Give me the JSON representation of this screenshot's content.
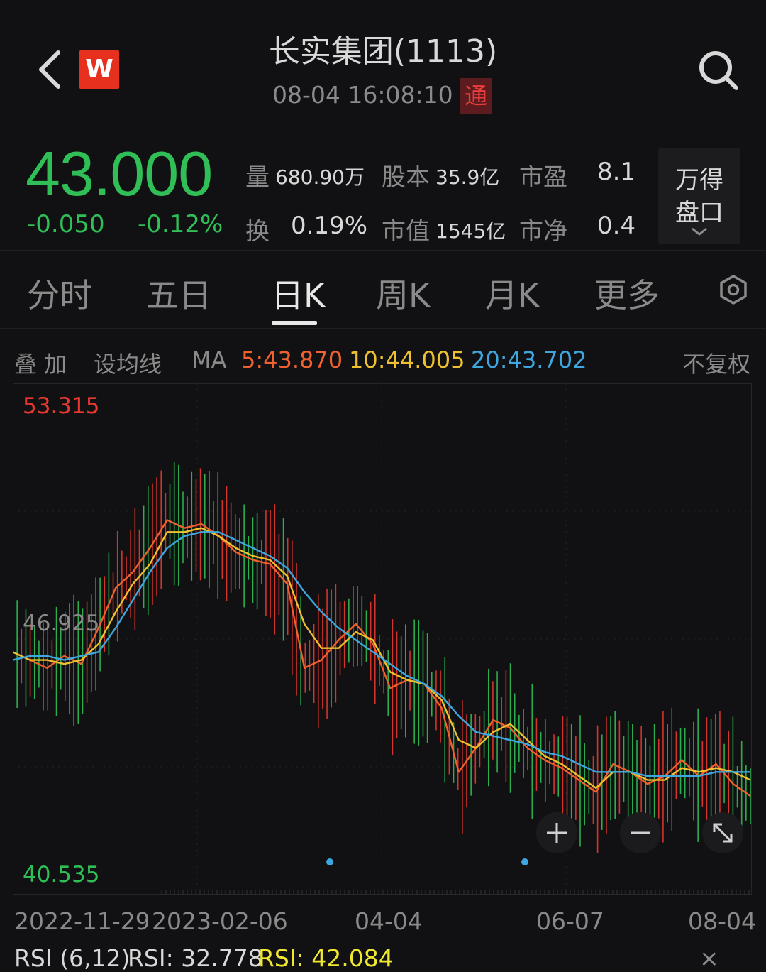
{
  "header": {
    "title": "长实集团(1113)",
    "datetime": "08-04 16:08:10",
    "tong_badge": "通",
    "logo_text": "W"
  },
  "quote": {
    "price": "43.000",
    "change": "-0.050",
    "change_pct": "-0.12%",
    "stats": {
      "volume_label": "量",
      "volume_value": "680.90万",
      "capital_label": "股本",
      "capital_value": "35.9亿",
      "pe_label": "市盈",
      "pe_value": "8.1",
      "turnover_label": "换",
      "turnover_value": "0.19%",
      "mcap_label": "市值",
      "mcap_value": "1545亿",
      "pb_label": "市净",
      "pb_value": "0.4"
    },
    "wind_button": {
      "line1": "万得",
      "line2": "盘口"
    }
  },
  "tabs": [
    {
      "label": "分时"
    },
    {
      "label": "五日"
    },
    {
      "label": "日K"
    },
    {
      "label": "周K"
    },
    {
      "label": "月K"
    },
    {
      "label": "更多"
    }
  ],
  "active_tab": "日K",
  "ma_bar": {
    "overlay": "叠 加",
    "set_ma": "设均线",
    "ma": "MA",
    "ma5": "5:43.870",
    "ma10": "10:44.005",
    "ma20": "20:43.702",
    "adjust": "不复权"
  },
  "colors": {
    "up": "#e8382f",
    "down": "#2fbf56",
    "ma5": "#f0612e",
    "ma10": "#efc12e",
    "ma20": "#3ea7df",
    "bg": "#111113"
  },
  "chart_data": {
    "type": "line",
    "y_max_label": "53.315",
    "y_mid_label": "46.925",
    "y_min_label": "40.535",
    "ylim": [
      40.535,
      53.315
    ],
    "x_labels": [
      "2022-11-29",
      "2023-02-06",
      "04-04",
      "06-07",
      "08-04"
    ],
    "x": [
      0,
      4,
      8,
      12,
      16,
      20,
      24,
      28,
      32,
      36,
      40,
      44,
      48,
      52,
      56,
      60,
      64,
      68,
      72,
      76,
      80,
      84,
      88,
      92,
      96,
      100,
      104,
      108,
      112,
      116,
      120,
      124,
      128,
      132,
      136,
      140,
      144,
      148,
      152,
      156,
      160,
      164,
      168,
      172
    ],
    "series": [
      {
        "name": "MA5",
        "values": [
          46.6,
          46.4,
          46.2,
          46.5,
          46.3,
          47.2,
          48.2,
          48.6,
          49.2,
          49.9,
          49.7,
          49.8,
          49.5,
          49.1,
          48.9,
          48.8,
          48.3,
          46.2,
          46.4,
          46.9,
          47.3,
          46.8,
          45.7,
          45.9,
          45.8,
          45.2,
          43.6,
          44.2,
          44.9,
          44.7,
          44.2,
          43.9,
          43.7,
          43.4,
          43.1,
          43.8,
          43.6,
          43.3,
          43.5,
          43.9,
          43.5,
          43.8,
          43.3,
          43.0
        ]
      },
      {
        "name": "MA10",
        "values": [
          46.6,
          46.4,
          46.4,
          46.3,
          46.4,
          46.8,
          47.6,
          48.3,
          48.8,
          49.6,
          49.6,
          49.7,
          49.5,
          49.2,
          49.0,
          48.9,
          48.5,
          47.3,
          46.7,
          46.7,
          47.1,
          46.9,
          46.1,
          45.9,
          45.8,
          45.4,
          44.4,
          44.2,
          44.6,
          44.8,
          44.4,
          44.0,
          43.8,
          43.5,
          43.2,
          43.6,
          43.6,
          43.4,
          43.4,
          43.7,
          43.6,
          43.7,
          43.6,
          43.4
        ]
      },
      {
        "name": "MA20",
        "values": [
          46.4,
          46.5,
          46.5,
          46.4,
          46.5,
          46.6,
          47.2,
          47.9,
          48.6,
          49.2,
          49.5,
          49.6,
          49.6,
          49.4,
          49.2,
          49.0,
          48.7,
          48.1,
          47.6,
          47.2,
          46.9,
          46.6,
          46.3,
          46.0,
          45.8,
          45.5,
          45.0,
          44.6,
          44.5,
          44.4,
          44.3,
          44.1,
          44.0,
          43.8,
          43.6,
          43.6,
          43.6,
          43.5,
          43.5,
          43.5,
          43.5,
          43.6,
          43.6,
          43.6
        ]
      }
    ]
  },
  "rsi": {
    "label": "RSI (6,12)",
    "rsi1": "RSI: 32.778",
    "rsi2": "RSI: 42.084",
    "close": "×"
  }
}
